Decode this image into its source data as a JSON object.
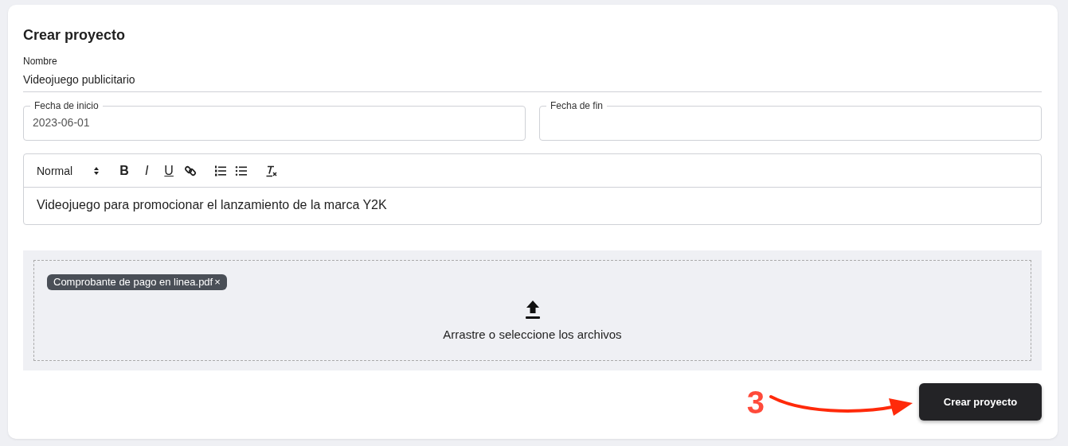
{
  "title": "Crear proyecto",
  "name_field": {
    "label": "Nombre",
    "value": "Videojuego publicitario"
  },
  "date_fields": [
    {
      "label": "Fecha de inicio",
      "value": "2023-06-01"
    },
    {
      "label": "Fecha de fin"
    }
  ],
  "editor": {
    "format_select": "Normal",
    "toolbar": [
      {
        "kind": "bold",
        "label": "B"
      },
      {
        "kind": "italic",
        "label": "I"
      },
      {
        "kind": "underline",
        "label": "U"
      },
      {
        "kind": "link"
      },
      {
        "kind": "ordered-list"
      },
      {
        "kind": "bullet-list"
      },
      {
        "kind": "clear-format"
      }
    ],
    "content": "Videojuego para promocionar el lanzamiento de la marca Y2K"
  },
  "dropzone": {
    "files": [
      {
        "name": "Comprobante de pago en linea.pdf",
        "remove": "×"
      }
    ],
    "prompt": "Arrastre o seleccione los archivos"
  },
  "submit_button": "Crear proyecto",
  "annotation": {
    "label": "3"
  }
}
